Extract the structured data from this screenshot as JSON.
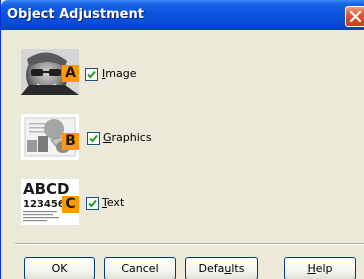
{
  "window": {
    "title": "Object Adjustment"
  },
  "options": [
    {
      "badge": "A",
      "label_first": "I",
      "label_rest": "mage",
      "checked": true,
      "thumbnail": "photo-face-thumbnail"
    },
    {
      "badge": "B",
      "label_first": "G",
      "label_rest": "raphics",
      "checked": true,
      "thumbnail": "graphics-thumbnail"
    },
    {
      "badge": "C",
      "label_first": "T",
      "label_rest": "ext",
      "checked": true,
      "thumbnail": "text-thumbnail"
    }
  ],
  "text_sample": {
    "line1": "ABCD",
    "line2": "123456"
  },
  "buttons": {
    "ok": "OK",
    "cancel": "Cancel",
    "defaults_pre": "Defa",
    "defaults_u": "u",
    "defaults_post": "lts",
    "help_u": "H",
    "help_post": "elp"
  },
  "colors": {
    "badge": "#ff9900",
    "titlebar": "#0a54e0",
    "dialog_bg": "#ece9d8"
  }
}
